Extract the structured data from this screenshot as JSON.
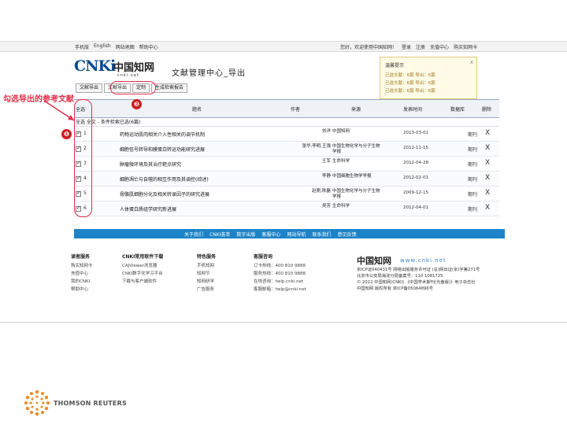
{
  "annotation": {
    "label": "勾选导出的参考文献",
    "step1": "❶",
    "step2": "❷"
  },
  "topbar": {
    "left": [
      "手机版",
      "English",
      "网站地图",
      "帮助中心"
    ],
    "right": [
      "您好，欢迎使用中国知网！",
      "登录",
      "注册",
      "充值中心",
      "购买知网卡"
    ]
  },
  "logo": {
    "brand": "CNKi",
    "cn": "中国知网",
    "url": "cnki.net"
  },
  "page_title": "文献管理中心_导出",
  "popup": {
    "title": "温馨提示",
    "lines": [
      "已选文献：6篇  导出：6篇",
      "已选文献：6篇  导出：6篇",
      "已选文献：6篇  导出：6篇"
    ]
  },
  "tabs": [
    "文献导出",
    "文献导出",
    "定制",
    "生成检索报告"
  ],
  "table": {
    "headers": {
      "check": "全选",
      "title": "题名",
      "author": "作者",
      "source": "来源",
      "date": "发表时间",
      "type": "数据库",
      "del": "删除"
    },
    "group": "全选 全文 - 条件检索已选(6篇)",
    "rows": [
      {
        "n": "1",
        "title": "药物运动肌肉相关介入性相关的调节机制",
        "author": "刘洋",
        "source": "中国知网",
        "date": "2013-03-01",
        "type": "期刊",
        "del": "X"
      },
      {
        "n": "2",
        "title": "细胞信号转导和膜蛋白转运功能研究进展",
        "author": "张华,李明,王强",
        "source": "中国生物化学与分子生物学报",
        "date": "2012-11-15",
        "type": "期刊",
        "del": "X"
      },
      {
        "n": "3",
        "title": "肿瘤微环境及其治疗靶点研究",
        "author": "王军",
        "source": "生命科学",
        "date": "2012-04-28",
        "type": "期刊",
        "del": "X"
      },
      {
        "n": "4",
        "title": "细胞凋亡与自噬的相互作用及其调控(综述)",
        "author": "李静",
        "source": "中国细胞生物学学报",
        "date": "2012-02-01",
        "type": "期刊",
        "del": "X"
      },
      {
        "n": "5",
        "title": "骨骼肌细胞分化及相关转录因子的研究进展",
        "author": "赵刚,陈磊",
        "source": "中国生物化学与分子生物学报",
        "date": "2009-12-15",
        "type": "期刊",
        "del": "X"
      },
      {
        "n": "6",
        "title": "人体蛋白质组学研究新进展",
        "author": "吴芳",
        "source": "生命科学",
        "date": "2012-04-01",
        "type": "期刊",
        "del": "X"
      }
    ]
  },
  "linkbar": [
    "关于我们",
    "CNKI荟萃",
    "数字出版",
    "客服中心",
    "网站导航",
    "联系我们",
    "意见反馈"
  ],
  "footer": {
    "cols": [
      {
        "head": "读者服务",
        "items": [
          "购买知网卡",
          "充值中心",
          "我的CNKI",
          "帮助中心"
        ]
      },
      {
        "head": "CNKI常用软件下载",
        "items": [
          "CAJViewer浏览器",
          "CNKI数字化学习平台",
          "下载与客户端软件"
        ]
      },
      {
        "head": "特色服务",
        "items": [
          "手机知网",
          "知网节",
          "知网研学",
          "广告服务"
        ]
      },
      {
        "head": "客服咨询",
        "items": [
          "订卡热线：400 810 9888",
          "服务热线：400 810 9888",
          "在线咨询：help.cnki.net",
          "客服邮箱：help@cnki.net"
        ]
      }
    ],
    "brand": {
      "logo": "中国知网",
      "url": "www.cnki.net",
      "lines": [
        "京ICP证040431号 网络出版服务许可证 (总)网出证(京)字第271号",
        "北京市公安局海淀分局备案号：110 1081725",
        "© 2012 中国知网(CNKI) 《中国学术期刊(光盘版)》电子杂志社",
        "中国知网 版权所有 京ICP备05064896号"
      ]
    }
  },
  "brand_mark": "THOMSON REUTERS"
}
